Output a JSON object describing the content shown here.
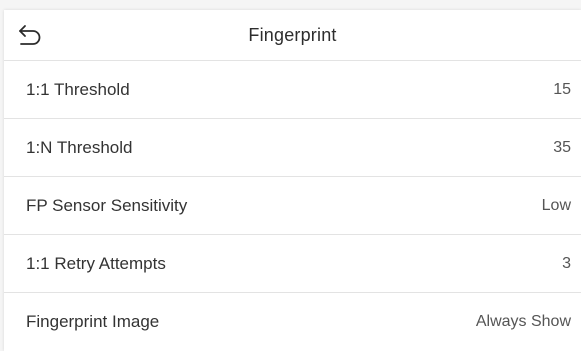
{
  "header": {
    "title": "Fingerprint",
    "back_icon": "back-arrow-icon"
  },
  "settings": [
    {
      "label": "1:1 Threshold",
      "value": "15"
    },
    {
      "label": "1:N Threshold",
      "value": "35"
    },
    {
      "label": "FP Sensor Sensitivity",
      "value": "Low"
    },
    {
      "label": "1:1 Retry Attempts",
      "value": "3"
    },
    {
      "label": "Fingerprint Image",
      "value": "Always Show"
    }
  ],
  "colors": {
    "background": "#ffffff",
    "divider": "#e3e3e3",
    "text": "#333333"
  }
}
